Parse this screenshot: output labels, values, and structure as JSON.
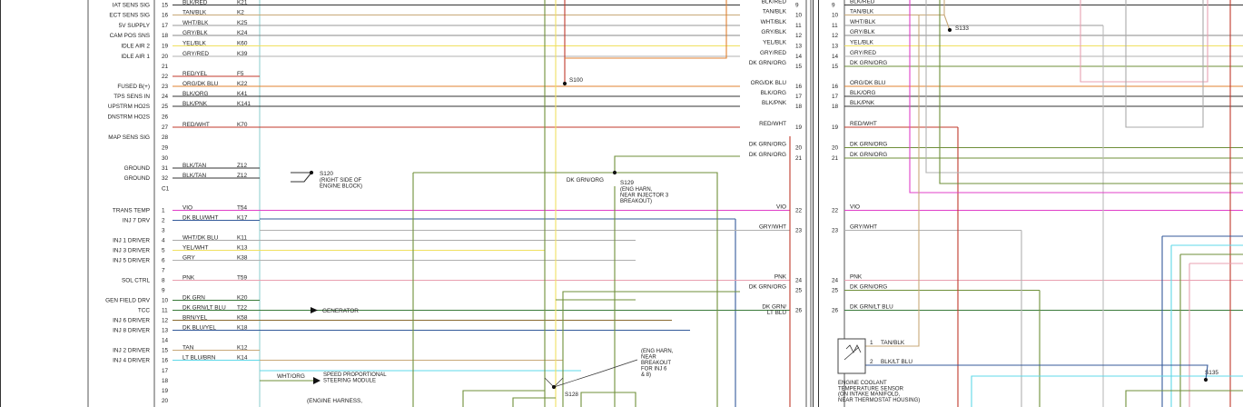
{
  "panel_a": {
    "pins": [
      {
        "pin": "15",
        "signal": "IAT SENS SIG",
        "color": "BLK/RED",
        "circuit": "K21"
      },
      {
        "pin": "16",
        "signal": "ECT SENS SIG",
        "color": "TAN/BLK",
        "circuit": "K2"
      },
      {
        "pin": "17",
        "signal": "5V SUPPLY",
        "color": "WHT/BLK",
        "circuit": "K25"
      },
      {
        "pin": "18",
        "signal": "CAM POS SNS",
        "color": "GRY/BLK",
        "circuit": "K24"
      },
      {
        "pin": "19",
        "signal": "IDLE AIR 2",
        "color": "YEL/BLK",
        "circuit": "K60"
      },
      {
        "pin": "20",
        "signal": "IDLE AIR 1",
        "color": "GRY/RED",
        "circuit": "K39"
      },
      {
        "pin": "21",
        "signal": "",
        "color": "",
        "circuit": ""
      },
      {
        "pin": "22",
        "signal": "",
        "color": "RED/YEL",
        "circuit": "F5"
      },
      {
        "pin": "23",
        "signal": "FUSED B(+)",
        "color": "ORG/DK BLU",
        "circuit": "K22"
      },
      {
        "pin": "24",
        "signal": "TPS SENS IN",
        "color": "BLK/ORG",
        "circuit": "K41"
      },
      {
        "pin": "25",
        "signal": "UPSTRM HO2S",
        "color": "BLK/PNK",
        "circuit": "K141"
      },
      {
        "pin": "26",
        "signal": "DNSTRM HO2S",
        "color": "",
        "circuit": ""
      },
      {
        "pin": "27",
        "signal": "",
        "color": "RED/WHT",
        "circuit": "K70"
      },
      {
        "pin": "28",
        "signal": "MAP SENS SIG",
        "color": "",
        "circuit": ""
      },
      {
        "pin": "29",
        "signal": "",
        "color": "",
        "circuit": ""
      },
      {
        "pin": "30",
        "signal": "",
        "color": "",
        "circuit": ""
      },
      {
        "pin": "31",
        "signal": "GROUND",
        "color": "BLK/TAN",
        "circuit": "Z12"
      },
      {
        "pin": "32",
        "signal": "GROUND",
        "color": "BLK/TAN",
        "circuit": "Z12"
      },
      {
        "pin": "C1",
        "signal": "",
        "color": "",
        "circuit": ""
      },
      {
        "pin": "1",
        "signal": "TRANS TEMP",
        "color": "VIO",
        "circuit": "T54"
      },
      {
        "pin": "2",
        "signal": "INJ 7 DRV",
        "color": "DK BLU/WHT",
        "circuit": "K17"
      },
      {
        "pin": "3",
        "signal": "",
        "color": "",
        "circuit": ""
      },
      {
        "pin": "4",
        "signal": "INJ 1 DRIVER",
        "color": "WHT/DK BLU",
        "circuit": "K11"
      },
      {
        "pin": "5",
        "signal": "INJ 3 DRIVER",
        "color": "YEL/WHT",
        "circuit": "K13"
      },
      {
        "pin": "6",
        "signal": "INJ 5 DRIVER",
        "color": "GRY",
        "circuit": "K38"
      },
      {
        "pin": "7",
        "signal": "",
        "color": "",
        "circuit": ""
      },
      {
        "pin": "8",
        "signal": "SOL CTRL",
        "color": "PNK",
        "circuit": "T59"
      },
      {
        "pin": "9",
        "signal": "",
        "color": "",
        "circuit": ""
      },
      {
        "pin": "10",
        "signal": "GEN FIELD DRV",
        "color": "DK GRN",
        "circuit": "K20"
      },
      {
        "pin": "11",
        "signal": "TCC",
        "color": "DK GRN/LT BLU",
        "circuit": "T22"
      },
      {
        "pin": "12",
        "signal": "INJ 6 DRIVER",
        "color": "BRN/YEL",
        "circuit": "K58"
      },
      {
        "pin": "13",
        "signal": "INJ 8 DRIVER",
        "color": "DK BLU/YEL",
        "circuit": "K18"
      },
      {
        "pin": "14",
        "signal": "",
        "color": "",
        "circuit": ""
      },
      {
        "pin": "15",
        "signal": "INJ 2 DRIVER",
        "color": "TAN",
        "circuit": "K12"
      },
      {
        "pin": "16",
        "signal": "INJ 4 DRIVER",
        "color": "LT BLU/BRN",
        "circuit": "K14"
      },
      {
        "pin": "17",
        "signal": "",
        "color": "",
        "circuit": ""
      },
      {
        "pin": "18",
        "signal": "",
        "color": "",
        "circuit": ""
      },
      {
        "pin": "19",
        "signal": "",
        "color": "",
        "circuit": ""
      },
      {
        "pin": "20",
        "signal": "",
        "color": "",
        "circuit": ""
      }
    ],
    "right_pins": [
      {
        "pin": "9",
        "color": "BLK/RED"
      },
      {
        "pin": "10",
        "color": "TAN/BLK"
      },
      {
        "pin": "11",
        "color": "WHT/BLK"
      },
      {
        "pin": "12",
        "color": "GRY/BLK"
      },
      {
        "pin": "13",
        "color": "YEL/BLK"
      },
      {
        "pin": "14",
        "color": "GRY/RED"
      },
      {
        "pin": "15",
        "color": "DK GRN/ORG"
      },
      {
        "pin": "16",
        "color": "ORG/DK BLU"
      },
      {
        "pin": "17",
        "color": "BLK/ORG"
      },
      {
        "pin": "18",
        "color": "BLK/PNK"
      },
      {
        "pin": "19",
        "color": "RED/WHT"
      },
      {
        "pin": "20",
        "color": "DK GRN/ORG"
      },
      {
        "pin": "21",
        "color": "DK GRN/ORG"
      },
      {
        "pin": "22",
        "color": "VIO"
      },
      {
        "pin": "23",
        "color": "GRY/WHT"
      },
      {
        "pin": "24",
        "color": "PNK"
      },
      {
        "pin": "25",
        "color": "DK GRN/ORG"
      },
      {
        "pin": "26",
        "color": "DK GRN/\nLT BLU"
      }
    ],
    "splice_s100": "S100",
    "splice_s120": "S120",
    "s120_note": "(RIGHT SIDE OF\nENGINE BLOCK)",
    "splice_s129": "S129",
    "s129_note": "(ENG HARN,\nNEAR INJECTOR 3\nBREAKOUT)",
    "s129_wire": "DK GRN/ORG",
    "splice_s128": "S128",
    "s128_note": "(ENG HARN,\nNEAR\nBREAKOUT\nFOR INJ 6\n& 8)",
    "generator": "GENERATOR",
    "steering_wire": "WHT/ORG",
    "steering_module": "SPEED PROPORTIONAL\nSTEERING MODULE",
    "bottom_note": "(ENGINE HARNESS,"
  },
  "panel_b": {
    "pins": [
      {
        "pin": "9",
        "color": "BLK/RED"
      },
      {
        "pin": "10",
        "color": "TAN/BLK"
      },
      {
        "pin": "11",
        "color": "WHT/BLK"
      },
      {
        "pin": "12",
        "color": "GRY/BLK"
      },
      {
        "pin": "13",
        "color": "YEL/BLK"
      },
      {
        "pin": "14",
        "color": "GRY/RED"
      },
      {
        "pin": "15",
        "color": "DK GRN/ORG"
      },
      {
        "pin": "16",
        "color": "ORG/DK BLU"
      },
      {
        "pin": "17",
        "color": "BLK/ORG"
      },
      {
        "pin": "18",
        "color": "BLK/PNK"
      },
      {
        "pin": "19",
        "color": "RED/WHT"
      },
      {
        "pin": "20",
        "color": "DK GRN/ORG"
      },
      {
        "pin": "21",
        "color": "DK GRN/ORG"
      },
      {
        "pin": "22",
        "color": "VIO"
      },
      {
        "pin": "23",
        "color": "GRY/WHT"
      },
      {
        "pin": "24",
        "color": "PNK"
      },
      {
        "pin": "25",
        "color": "DK GRN/ORG"
      },
      {
        "pin": "26",
        "color": "DK GRN/LT BLU"
      }
    ],
    "splice_s133": "S133",
    "splice_s135": "S135",
    "sensor_pin1": "1",
    "sensor_pin1_wire": "TAN/BLK",
    "sensor_pin2": "2",
    "sensor_pin2_wire": "BLK/LT BLU",
    "sensor_name": "ENGINE COOLANT\nTEMPERATURE SENSOR\n(ON INTAKE MANIFOLD,\nNEAR THERMOSTAT HOUSING)"
  },
  "colors": {
    "dk_grn_org": "#6f8f3a",
    "red": "#c0392b",
    "vio": "#e040c8",
    "pnk": "#e8a0b0",
    "gry": "#b0b0b0",
    "yel": "#f0e060",
    "org": "#e08030",
    "tan": "#c8a878",
    "dk_blu": "#345a9a",
    "lt_blu": "#5fd8e8",
    "blk": "#333333",
    "dk_grn": "#3a7a3a"
  }
}
